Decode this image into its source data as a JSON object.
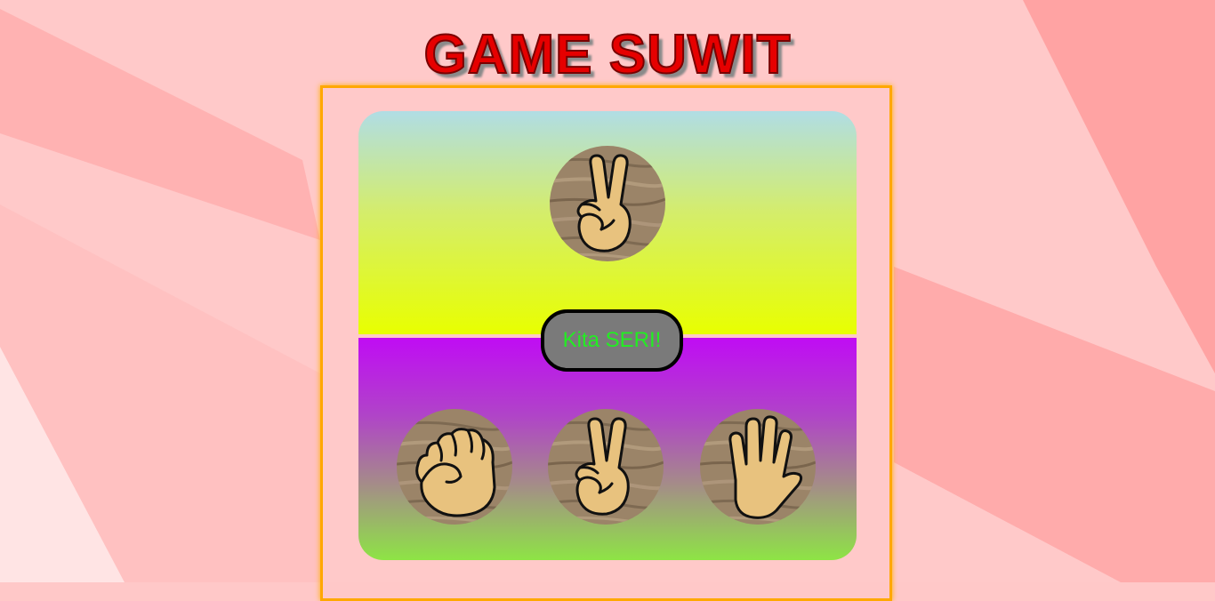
{
  "title": "GAME SUWIT",
  "result_text": "Kita SERI!",
  "computer_choice": "gunting",
  "player_choices": [
    {
      "id": "batu",
      "icon": "fist-icon"
    },
    {
      "id": "gunting",
      "icon": "peace-hand-icon"
    },
    {
      "id": "kertas",
      "icon": "open-palm-icon"
    }
  ],
  "colors": {
    "title": "#e60000",
    "frame": "#ffa800",
    "result_text": "#22ee22",
    "result_bg": "#7a7a7a"
  }
}
